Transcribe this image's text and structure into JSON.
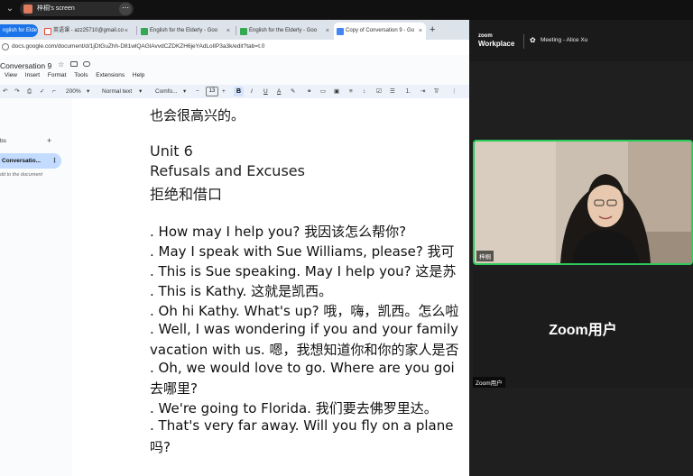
{
  "share_bar": {
    "title": "梓桐's screen",
    "more": "⋯"
  },
  "tabs": [
    {
      "label": "nglish for Elde",
      "first": true
    },
    {
      "label": "英语课 - azz25710@gmail.co",
      "icon": "gmail-icon"
    },
    {
      "label": "English for the Elderly - Goo",
      "icon": "docs-icon"
    },
    {
      "label": "English for the Elderly - Goo",
      "icon": "docs-icon"
    },
    {
      "label": "Copy of Conversation 9 - Go",
      "icon": "docs-icon",
      "active": true
    }
  ],
  "address": "docs.google.com/document/d/1jDtGuZhh-D81wlQAGlAvvdCZDKZH6jeYAdLolIP3a3k/edit?tab=t.0",
  "doc": {
    "title": "Conversation 9",
    "menus": [
      "View",
      "Insert",
      "Format",
      "Tools",
      "Extensions",
      "Help"
    ]
  },
  "toolbar": {
    "zoom": "200%",
    "style": "Normal text",
    "font": "Comfo...",
    "font_size": "13",
    "bold": "B",
    "italic": "I",
    "underline": "U",
    "text_color": "A"
  },
  "outline": {
    "tabs_label": "bs",
    "item": "Conversatio...",
    "hint": "dd to the document"
  },
  "content": {
    "lines": [
      "也会很高兴的。",
      "",
      "Unit 6",
      "Refusals and Excuses",
      "拒绝和借口",
      "",
      ". How may I help you? 我因该怎么帮你?",
      ". May I speak with Sue Williams, please? 我可",
      ". This is Sue speaking. May I help you? 这是苏",
      ". This is Kathy. 这就是凯西。",
      ". Oh hi Kathy. What's up? 哦，嗨，凯西。怎么啦",
      ". Well, I was wondering if you and your family",
      "vacation with us. 嗯，我想知道你和你的家人是否",
      ". Oh, we would love to go. Where are you goi",
      "去哪里?",
      ". We're going to Florida. 我们要去佛罗里达。",
      ". That's very far away. Will you fly on a plane",
      "吗?"
    ]
  },
  "zoom": {
    "logo_top": "zoom",
    "logo_bottom": "Workplace",
    "meeting_title": "Meeting - Alice Xu",
    "participant_name": "梓桐",
    "user_center": "Zoom用户",
    "user_tag": "Zoom用户"
  }
}
